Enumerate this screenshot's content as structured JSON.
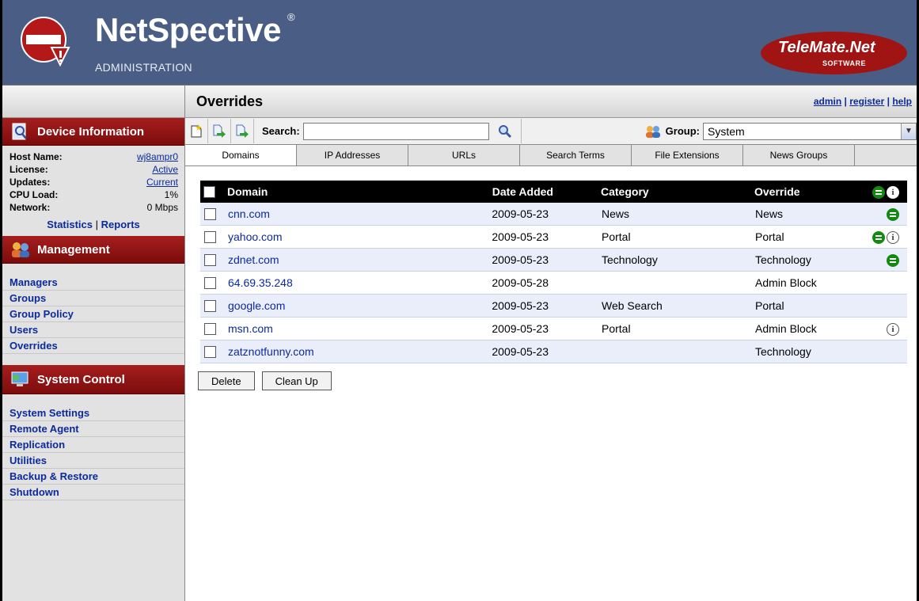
{
  "header": {
    "brand": "NetSpective",
    "brand_mark": "®",
    "subtitle": "ADMINISTRATION",
    "partner_name": "TeleMate.Net",
    "partner_sub": "SOFTWARE"
  },
  "sidebar": {
    "device_title": "Device Information",
    "info": [
      {
        "label": "Host Name:",
        "value": "wj8ampr0",
        "link": true
      },
      {
        "label": "License:",
        "value": "Active",
        "link": true
      },
      {
        "label": "Updates:",
        "value": "Current",
        "link": true
      },
      {
        "label": "CPU Load:",
        "value": "1%",
        "link": false
      },
      {
        "label": "Network:",
        "value": "0 Mbps",
        "link": false
      }
    ],
    "statistics_label": "Statistics",
    "separator": "|",
    "reports_label": "Reports",
    "management_title": "Management",
    "management_items": [
      "Managers",
      "Groups",
      "Group Policy",
      "Users",
      "Overrides"
    ],
    "system_title": "System Control",
    "system_items": [
      "System Settings",
      "Remote Agent",
      "Replication",
      "Utilities",
      "Backup & Restore",
      "Shutdown"
    ]
  },
  "main": {
    "title": "Overrides",
    "links": {
      "admin": "admin",
      "register": "register",
      "help": "help",
      "sep": "|"
    },
    "toolbar": {
      "search_label": "Search:",
      "search_value": "",
      "group_label": "Group:",
      "group_value": "System"
    },
    "tabs": [
      "Domains",
      "IP Addresses",
      "URLs",
      "Search Terms",
      "File Extensions",
      "News Groups"
    ],
    "active_tab": 0,
    "table": {
      "columns": [
        "Domain",
        "Date Added",
        "Category",
        "Override"
      ],
      "rows": [
        {
          "domain": "cnn.com",
          "date": "2009-05-23",
          "category": "News",
          "override": "News",
          "eq": true,
          "info": false
        },
        {
          "domain": "yahoo.com",
          "date": "2009-05-23",
          "category": "Portal",
          "override": "Portal",
          "eq": true,
          "info": true
        },
        {
          "domain": "zdnet.com",
          "date": "2009-05-23",
          "category": "Technology",
          "override": "Technology",
          "eq": true,
          "info": false
        },
        {
          "domain": "64.69.35.248",
          "date": "2009-05-28",
          "category": "",
          "override": "Admin Block",
          "eq": false,
          "info": false
        },
        {
          "domain": "google.com",
          "date": "2009-05-23",
          "category": "Web Search",
          "override": "Portal",
          "eq": false,
          "info": false
        },
        {
          "domain": "msn.com",
          "date": "2009-05-23",
          "category": "Portal",
          "override": "Admin Block",
          "eq": false,
          "info": true
        },
        {
          "domain": "zatznotfunny.com",
          "date": "2009-05-23",
          "category": "",
          "override": "Technology",
          "eq": false,
          "info": false
        }
      ]
    },
    "buttons": {
      "delete": "Delete",
      "cleanup": "Clean Up"
    }
  },
  "colors": {
    "header_bg": "#4a5d85",
    "section_red": "#8c1313",
    "link_blue": "#0b2a9c",
    "row_alt": "#e9eefa"
  }
}
